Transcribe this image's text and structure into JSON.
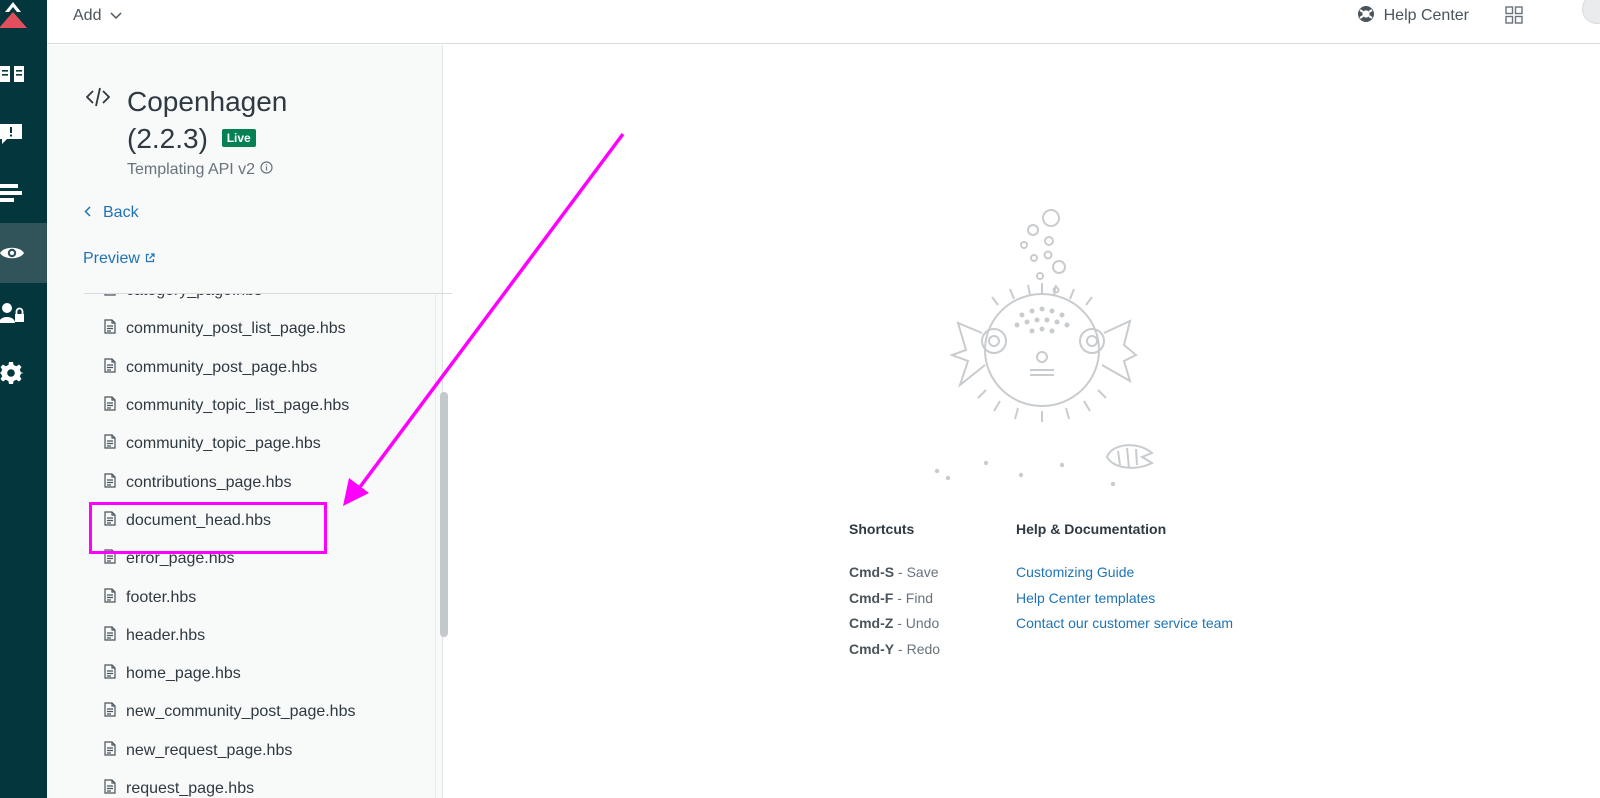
{
  "topbar": {
    "add_label": "Add",
    "help_center_label": "Help Center"
  },
  "rail": {
    "items": [
      "zendesk-logo",
      "guide-icon",
      "feedback-icon",
      "arrange-icon",
      "eye-icon",
      "user-lock-icon",
      "gear-icon"
    ],
    "active": "eye-icon"
  },
  "theme": {
    "name": "Copenhagen (2.2.3)",
    "name_line1": "Copenhagen",
    "name_line2": "(2.2.3)",
    "status_badge": "Live",
    "api_version": "Templating API v2"
  },
  "nav": {
    "back_label": "Back",
    "preview_label": "Preview"
  },
  "files": [
    "category_page.hbs",
    "community_post_list_page.hbs",
    "community_post_page.hbs",
    "community_topic_list_page.hbs",
    "community_topic_page.hbs",
    "contributions_page.hbs",
    "document_head.hbs",
    "error_page.hbs",
    "footer.hbs",
    "header.hbs",
    "home_page.hbs",
    "new_community_post_page.hbs",
    "new_request_page.hbs",
    "request_page.hbs"
  ],
  "highlighted_file": "document_head.hbs",
  "shortcuts": {
    "title": "Shortcuts",
    "items": [
      {
        "key": "Cmd-S",
        "action": "Save"
      },
      {
        "key": "Cmd-F",
        "action": "Find"
      },
      {
        "key": "Cmd-Z",
        "action": "Undo"
      },
      {
        "key": "Cmd-Y",
        "action": "Redo"
      }
    ]
  },
  "help_docs": {
    "title": "Help & Documentation",
    "links": [
      "Customizing Guide",
      "Help Center templates",
      "Contact our customer service team"
    ]
  },
  "colors": {
    "rail_bg": "#03363d",
    "rail_active": "#30545a",
    "link": "#1f73b7",
    "live_badge": "#038153",
    "annotation": "#ff00ff",
    "logo_red": "#e34f5c"
  }
}
